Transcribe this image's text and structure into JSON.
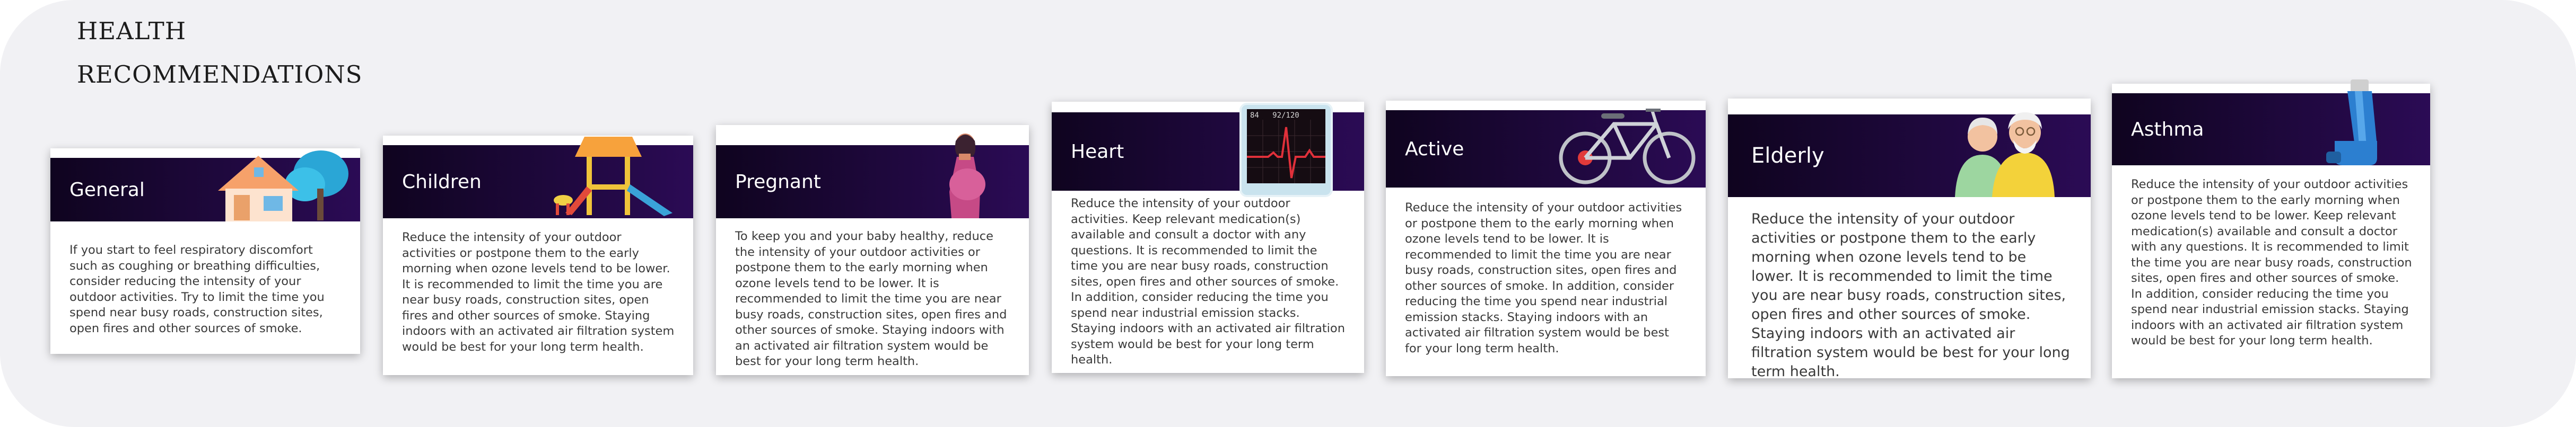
{
  "page": {
    "title_line1": "HEALTH",
    "title_line2": "RECOMMENDATIONS"
  },
  "colors": {
    "background": "#f1f1f4",
    "band_dark": "#0f041f",
    "band_purple": "#2b0b55",
    "card": "#ffffff"
  },
  "cards": [
    {
      "label": "General",
      "icon": "house-tree-icon",
      "text": "If you start to feel respiratory discomfort such as coughing or breathing difficulties, consider reducing the intensity of your outdoor activities. Try to limit the time you spend near busy roads, construction sites, open fires and other sources of smoke."
    },
    {
      "label": "Children",
      "icon": "playground-icon",
      "text": "Reduce the intensity of your outdoor activities or postpone them to the early morning when ozone levels tend to be lower. It is recommended to limit the time you are near busy roads, construction sites, open fires and other sources of smoke. Staying indoors with an activated air filtration system would be best for your long term health."
    },
    {
      "label": "Pregnant",
      "icon": "pregnant-woman-icon",
      "text": "To keep you and your baby healthy, reduce the intensity of your outdoor activities or postpone them to the early morning when ozone levels tend to be lower. It is recommended to limit the time you are near busy roads, construction sites, open fires and other sources of smoke. Staying indoors with an activated air filtration system would be best for your long term health."
    },
    {
      "label": "Heart",
      "icon": "heart-monitor-icon",
      "monitor_readout": "84   92/120",
      "text": "Reduce the intensity of your outdoor activities. Keep relevant medication(s) available and consult a doctor with any questions. It is recommended to limit the time you are near busy roads, construction sites, open fires and other sources of smoke. In addition, consider reducing the time you spend near industrial emission stacks. Staying indoors with an activated air filtration system would be best for your long term health."
    },
    {
      "label": "Active",
      "icon": "bicycle-icon",
      "text": "Reduce the intensity of your outdoor activities or postpone them to the early morning when ozone levels tend to be lower. It is recommended to limit the time you are near busy roads, construction sites, open fires and other sources of smoke. In addition, consider reducing the time you spend near industrial emission stacks. Staying indoors with an activated air filtration system would be best for your long term health."
    },
    {
      "label": "Elderly",
      "icon": "elderly-couple-icon",
      "text": "Reduce the intensity of your outdoor activities or postpone them to the early morning when ozone levels tend to be lower. It is recommended to limit the time you are near busy roads, construction sites, open fires and other sources of smoke. Staying indoors with an activated air filtration system would be best for your long term health."
    },
    {
      "label": "Asthma",
      "icon": "inhaler-icon",
      "text": "Reduce the intensity of your outdoor activities or postpone them to the early morning when ozone levels tend to be lower. Keep relevant medication(s) available and consult a doctor with any questions. It is recommended to limit the time you are near busy roads, construction sites, open fires and other sources of smoke. In addition, consider reducing the time you spend near industrial emission stacks. Staying indoors with an activated air filtration system would be best for your long term health."
    }
  ]
}
